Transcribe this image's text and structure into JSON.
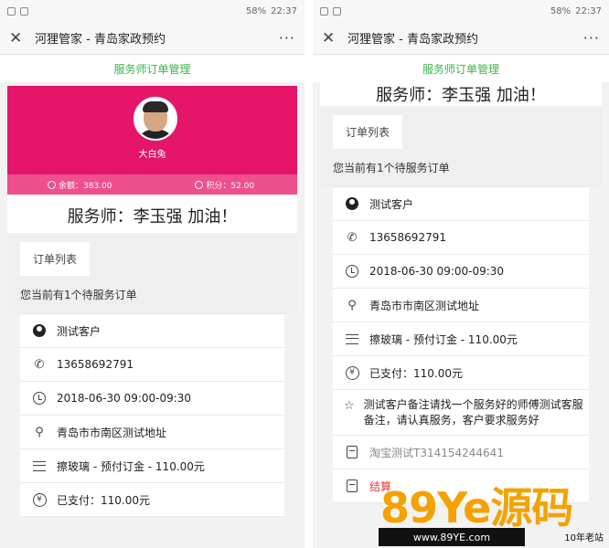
{
  "status": {
    "battery": "58%",
    "time": "22:37"
  },
  "titlebar": {
    "close": "✕",
    "title": "河狸管家 - 青岛家政预约",
    "more": "···"
  },
  "subbar": {
    "label": "服务师订单管理"
  },
  "hero": {
    "name": "大白兔",
    "balance_label": "余额：383.00",
    "points_label": "积分：52.00"
  },
  "greeting": "服务师：李玉强 加油！",
  "tab": {
    "label": "订单列表"
  },
  "notice": "您当前有1个待服务订单",
  "order": {
    "customer": "测试客户",
    "phone": "13658692791",
    "time": "2018-06-30 09:00-09:30",
    "address": "青岛市市南区测试地址",
    "item": "擦玻璃 - 预付订金 - 110.00元",
    "paid": "已支付：110.00元",
    "remark": "测试客户备注请找一个服务好的师傅测试客服备注，请认真服务，客户要求服务好",
    "taobao": "淘宝测试T314154244641",
    "settle": "结算"
  },
  "icons": {
    "star": "☆",
    "yen": "¥"
  },
  "watermark": {
    "brand": "89Ye源码",
    "url": "www.89YE.com",
    "tag": "10年老站"
  }
}
